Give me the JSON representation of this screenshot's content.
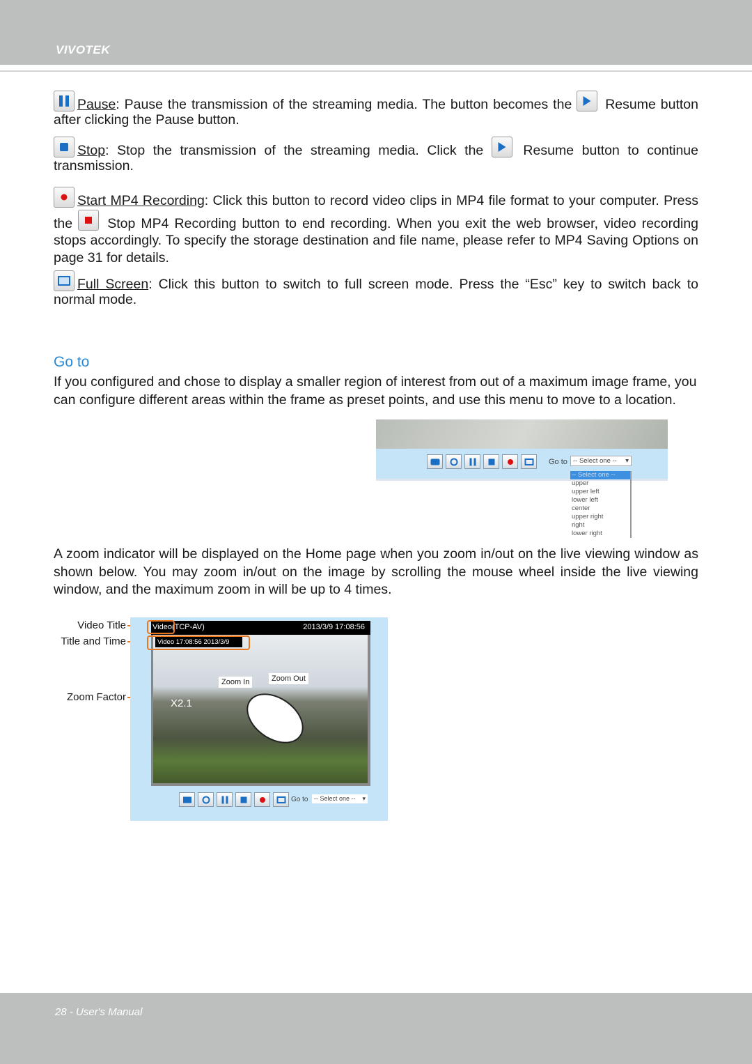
{
  "header": {
    "brand": "VIVOTEK"
  },
  "footer": {
    "page": "28 - User's Manual"
  },
  "items": [
    {
      "icon": "pause-icon",
      "link": "Pause",
      "text1": ": Pause the transmission of the streaming media. The button becomes the ",
      "icon2": "resume-icon",
      "text2": " Resume button after clicking the Pause button."
    },
    {
      "icon": "stop-icon",
      "link": "Stop",
      "text1": ": Stop the transmission of the streaming media. Click the ",
      "icon2": "resume-icon",
      "text2": " Resume button to continue transmission."
    },
    {
      "icon": "record-icon",
      "link": "Start MP4 Recording",
      "text1": ": Click this button to record video clips in MP4 file format to your computer. Press the ",
      "icon2": "stop-record-icon",
      "text2": " Stop MP4 Recording button to end recording. When you exit the web browser, video recording stops accordingly. To specify the storage destination and file name, please refer to MP4 Saving Options on page 31 for details."
    },
    {
      "icon": "fullscreen-icon",
      "link": "Full Screen",
      "text1": ": Click this button to switch to full screen mode. Press the “Esc” key to switch back to normal mode."
    }
  ],
  "goto": {
    "heading": "Go to",
    "body": "If you configured and chose to display a smaller region of interest from out of a maximum image frame, you can configure different areas within the frame as preset points, and use this menu to move to a location.",
    "screenshot": {
      "label": "Go to",
      "selected": "-- Select one --",
      "options": [
        "-- Select one --",
        "upper",
        "upper left",
        "lower left",
        "center",
        "upper right",
        "right",
        "lower right"
      ]
    }
  },
  "zoom": {
    "body": "A zoom indicator will be displayed on the Home page when you zoom in/out on the live viewing window as shown below. You may zoom in/out on the image by scrolling the mouse wheel inside the live viewing window, and the maximum zoom in will be up to 4 times.",
    "labels": {
      "video_title": "Video Title",
      "title_time": "Title and Time",
      "zoom_factor": "Zoom Factor"
    },
    "screenshot": {
      "title": "Video",
      "protocol": "(TCP-AV)",
      "datetime": "2013/3/9  17:08:56",
      "overlay": "Video 17:08:56  2013/3/9",
      "zoom_factor": "X2.1",
      "zoom_in": "Zoom In",
      "zoom_out": "Zoom Out",
      "goto_label": "Go to",
      "goto_selected": "-- Select one --"
    }
  }
}
